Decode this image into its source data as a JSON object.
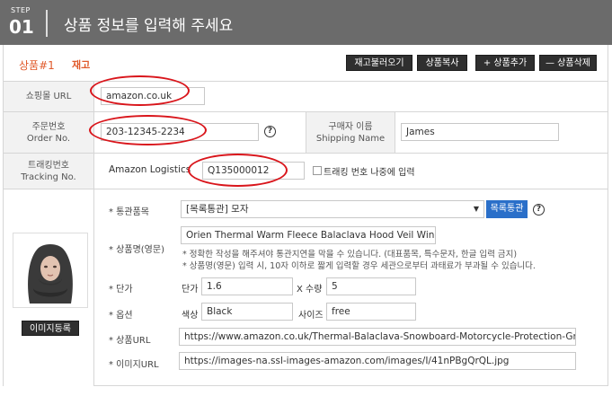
{
  "header": {
    "step_label": "STEP",
    "step_num": "01",
    "title": "상품 정보를 입력해 주세요"
  },
  "tabbar": {
    "product_tag": "상품#1",
    "stock_tag": "재고",
    "buttons": {
      "load_stock": "재고불러오기",
      "copy_product": "상품복사",
      "add_product": "+ 상품추가",
      "delete_product": "— 상품삭제"
    }
  },
  "form": {
    "shop_url": {
      "label": "쇼핑몰 URL",
      "value": "amazon.co.uk"
    },
    "order_no": {
      "label_ko": "주문번호",
      "label_en": "Order No.",
      "value": "203-12345-2234"
    },
    "buyer_name": {
      "label_ko": "구매자 이름",
      "label_en": "Shipping Name",
      "value": "James"
    },
    "tracking": {
      "label_ko": "트래킹번호",
      "label_en": "Tracking No.",
      "carrier": "Amazon Logistics",
      "value": "Q135000012",
      "later_label": "트래킹 번호 나중에 입력"
    }
  },
  "detail": {
    "customs_item": {
      "label": "* 통관품목",
      "value": "[목록통관] 모자",
      "button": "목록통관"
    },
    "product_name": {
      "label": "* 상품명(영문)",
      "value": "Orien Thermal Warm Fleece Balaclava Hood Veil Wind Proof",
      "note1": "* 정확한 작성을 해주셔야 통관지연을 막을 수 있습니다. (대표품목, 특수문자, 한글 입력 금지)",
      "note2": "* 상품명(영문) 입력 시, 10자 이하로 짧게 입력할 경우 세관으로부터 과태료가 부과될 수 있습니다."
    },
    "price": {
      "label": "* 단가",
      "price_label": "단가",
      "price_value": "1.6",
      "qty_label": "X 수량",
      "qty_value": "5"
    },
    "option": {
      "label": "* 옵션",
      "color_label": "색상",
      "color_value": "Black",
      "size_label": "사이즈",
      "size_value": "free"
    },
    "product_url": {
      "label": "* 상품URL",
      "value": "https://www.amazon.co.uk/Thermal-Balaclava-Snowboard-Motorcycle-Protection-Grey/dp/B"
    },
    "image_url": {
      "label": "* 이미지URL",
      "value": "https://images-na.ssl-images-amazon.com/images/I/41nPBgQrQL.jpg"
    },
    "register_image": "이미지등록"
  },
  "colors": {
    "header_bg": "#6b6b6b",
    "accent_orange": "#e05a2b",
    "annotation_red": "#d9151b",
    "button_blue": "#2a6fc9"
  }
}
